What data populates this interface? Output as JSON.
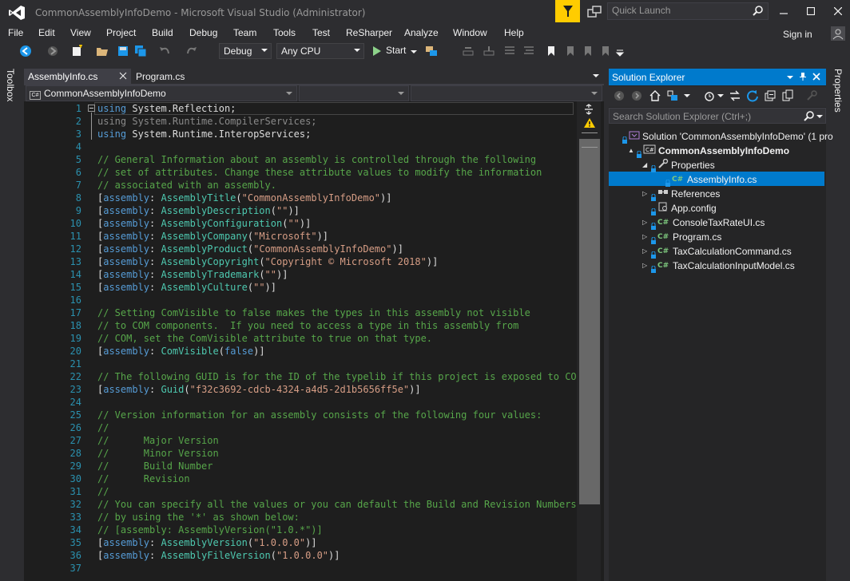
{
  "window": {
    "title": "CommonAssemblyInfoDemo - Microsoft Visual Studio  (Administrator)",
    "quick_launch_placeholder": "Quick Launch",
    "sign_in": "Sign in"
  },
  "menu": [
    "File",
    "Edit",
    "View",
    "Project",
    "Build",
    "Debug",
    "Team",
    "Tools",
    "Test",
    "ReSharper",
    "Analyze",
    "Window",
    "Help"
  ],
  "toolbar": {
    "configuration": "Debug",
    "platform": "Any CPU",
    "start_label": "Start"
  },
  "side_panels": {
    "left": "Toolbox",
    "right": "Properties"
  },
  "editor": {
    "tabs": [
      {
        "label": "AssemblyInfo.cs",
        "active": true
      },
      {
        "label": "Program.cs",
        "active": false
      }
    ],
    "nav_project": "CommonAssemblyInfoDemo",
    "line_numbers": [
      "1",
      "2",
      "3",
      "4",
      "5",
      "6",
      "7",
      "8",
      "9",
      "10",
      "11",
      "12",
      "13",
      "14",
      "15",
      "16",
      "17",
      "18",
      "19",
      "20",
      "21",
      "22",
      "23",
      "24",
      "25",
      "26",
      "27",
      "28",
      "29",
      "30",
      "31",
      "32",
      "33",
      "34",
      "35",
      "36",
      "37"
    ],
    "lines": [
      [
        [
          "kw",
          "using"
        ],
        [
          "ns",
          " System.Reflection;"
        ]
      ],
      [
        [
          "dim",
          "using System.Runtime.CompilerServices;"
        ]
      ],
      [
        [
          "kw",
          "using"
        ],
        [
          "ns",
          " System.Runtime.InteropServices;"
        ]
      ],
      [],
      [
        [
          "cm",
          "// General Information about an assembly is controlled through the following"
        ]
      ],
      [
        [
          "cm",
          "// set of attributes. Change these attribute values to modify the information"
        ]
      ],
      [
        [
          "cm",
          "// associated with an assembly."
        ]
      ],
      [
        [
          "ns",
          "["
        ],
        [
          "kw",
          "assembly"
        ],
        [
          "ns",
          ": "
        ],
        [
          "ty",
          "AssemblyTitle"
        ],
        [
          "ns",
          "("
        ],
        [
          "st",
          "\"CommonAssemblyInfoDemo\""
        ],
        [
          "ns",
          ")]"
        ]
      ],
      [
        [
          "ns",
          "["
        ],
        [
          "kw",
          "assembly"
        ],
        [
          "ns",
          ": "
        ],
        [
          "ty",
          "AssemblyDescription"
        ],
        [
          "ns",
          "("
        ],
        [
          "st",
          "\"\""
        ],
        [
          "ns",
          ")]"
        ]
      ],
      [
        [
          "ns",
          "["
        ],
        [
          "kw",
          "assembly"
        ],
        [
          "ns",
          ": "
        ],
        [
          "ty",
          "AssemblyConfiguration"
        ],
        [
          "ns",
          "("
        ],
        [
          "st",
          "\"\""
        ],
        [
          "ns",
          ")]"
        ]
      ],
      [
        [
          "ns",
          "["
        ],
        [
          "kw",
          "assembly"
        ],
        [
          "ns",
          ": "
        ],
        [
          "ty",
          "AssemblyCompany"
        ],
        [
          "ns",
          "("
        ],
        [
          "st",
          "\"Microsoft\""
        ],
        [
          "ns",
          ")]"
        ]
      ],
      [
        [
          "ns",
          "["
        ],
        [
          "kw",
          "assembly"
        ],
        [
          "ns",
          ": "
        ],
        [
          "ty",
          "AssemblyProduct"
        ],
        [
          "ns",
          "("
        ],
        [
          "st",
          "\"CommonAssemblyInfoDemo\""
        ],
        [
          "ns",
          ")]"
        ]
      ],
      [
        [
          "ns",
          "["
        ],
        [
          "kw",
          "assembly"
        ],
        [
          "ns",
          ": "
        ],
        [
          "ty",
          "AssemblyCopyright"
        ],
        [
          "ns",
          "("
        ],
        [
          "st",
          "\"Copyright © Microsoft 2018\""
        ],
        [
          "ns",
          ")]"
        ]
      ],
      [
        [
          "ns",
          "["
        ],
        [
          "kw",
          "assembly"
        ],
        [
          "ns",
          ": "
        ],
        [
          "ty",
          "AssemblyTrademark"
        ],
        [
          "ns",
          "("
        ],
        [
          "st",
          "\"\""
        ],
        [
          "ns",
          ")]"
        ]
      ],
      [
        [
          "ns",
          "["
        ],
        [
          "kw",
          "assembly"
        ],
        [
          "ns",
          ": "
        ],
        [
          "ty",
          "AssemblyCulture"
        ],
        [
          "ns",
          "("
        ],
        [
          "st",
          "\"\""
        ],
        [
          "ns",
          ")]"
        ]
      ],
      [],
      [
        [
          "cm",
          "// Setting ComVisible to false makes the types in this assembly not visible"
        ]
      ],
      [
        [
          "cm",
          "// to COM components.  If you need to access a type in this assembly from"
        ]
      ],
      [
        [
          "cm",
          "// COM, set the ComVisible attribute to true on that type."
        ]
      ],
      [
        [
          "ns",
          "["
        ],
        [
          "kw",
          "assembly"
        ],
        [
          "ns",
          ": "
        ],
        [
          "ty",
          "ComVisible"
        ],
        [
          "ns",
          "("
        ],
        [
          "kw",
          "false"
        ],
        [
          "ns",
          ")]"
        ]
      ],
      [],
      [
        [
          "cm",
          "// The following GUID is for the ID of the typelib if this project is exposed to COM"
        ]
      ],
      [
        [
          "ns",
          "["
        ],
        [
          "kw",
          "assembly"
        ],
        [
          "ns",
          ": "
        ],
        [
          "ty",
          "Guid"
        ],
        [
          "ns",
          "("
        ],
        [
          "st",
          "\"f32c3692-cdcb-4324-a4d5-2d1b5656ff5e\""
        ],
        [
          "ns",
          ")]"
        ]
      ],
      [],
      [
        [
          "cm",
          "// Version information for an assembly consists of the following four values:"
        ]
      ],
      [
        [
          "cm",
          "//"
        ]
      ],
      [
        [
          "cm",
          "//      Major Version"
        ]
      ],
      [
        [
          "cm",
          "//      Minor Version"
        ]
      ],
      [
        [
          "cm",
          "//      Build Number"
        ]
      ],
      [
        [
          "cm",
          "//      Revision"
        ]
      ],
      [
        [
          "cm",
          "//"
        ]
      ],
      [
        [
          "cm",
          "// You can specify all the values or you can default the Build and Revision Numbers"
        ]
      ],
      [
        [
          "cm",
          "// by using the '*' as shown below:"
        ]
      ],
      [
        [
          "cm",
          "// [assembly: AssemblyVersion(\"1.0.*\")]"
        ]
      ],
      [
        [
          "ns",
          "["
        ],
        [
          "kw",
          "assembly"
        ],
        [
          "ns",
          ": "
        ],
        [
          "ty",
          "AssemblyVersion"
        ],
        [
          "ns",
          "("
        ],
        [
          "st",
          "\"1.0.0.0\""
        ],
        [
          "ns",
          ")]"
        ]
      ],
      [
        [
          "ns",
          "["
        ],
        [
          "kw",
          "assembly"
        ],
        [
          "ns",
          ": "
        ],
        [
          "ty",
          "AssemblyFileVersion"
        ],
        [
          "ns",
          "("
        ],
        [
          "st",
          "\"1.0.0.0\""
        ],
        [
          "ns",
          ")]"
        ]
      ],
      []
    ]
  },
  "solution_explorer": {
    "title": "Solution Explorer",
    "search_placeholder": "Search Solution Explorer (Ctrl+;)",
    "tree": [
      {
        "label": "Solution 'CommonAssemblyInfoDemo' (1 pro",
        "indent": 0,
        "icon": "solution-icon",
        "expander": "",
        "bold": false
      },
      {
        "label": "CommonAssemblyInfoDemo",
        "indent": 1,
        "icon": "csproj-icon",
        "expander": "▲",
        "bold": true
      },
      {
        "label": "Properties",
        "indent": 2,
        "icon": "wrench-icon",
        "expander": "◢",
        "bold": false
      },
      {
        "label": "AssemblyInfo.cs",
        "indent": 3,
        "icon": "cs-file-icon",
        "expander": "",
        "bold": false,
        "selected": true
      },
      {
        "label": "References",
        "indent": 2,
        "icon": "references-icon",
        "expander": "▷",
        "bold": false
      },
      {
        "label": "App.config",
        "indent": 2,
        "icon": "config-icon",
        "expander": "",
        "bold": false
      },
      {
        "label": "ConsoleTaxRateUI.cs",
        "indent": 2,
        "icon": "cs-file-icon",
        "expander": "▷",
        "bold": false
      },
      {
        "label": "Program.cs",
        "indent": 2,
        "icon": "cs-file-icon",
        "expander": "▷",
        "bold": false
      },
      {
        "label": "TaxCalculationCommand.cs",
        "indent": 2,
        "icon": "cs-file-icon",
        "expander": "▷",
        "bold": false
      },
      {
        "label": "TaxCalculationInputModel.cs",
        "indent": 2,
        "icon": "cs-file-icon",
        "expander": "▷",
        "bold": false
      }
    ]
  },
  "colors": {
    "accent": "#007acc",
    "notification": "#ffcc00",
    "keyword": "#569cd6",
    "comment": "#57a64a",
    "string": "#d69d85",
    "type": "#4ec9b0"
  }
}
